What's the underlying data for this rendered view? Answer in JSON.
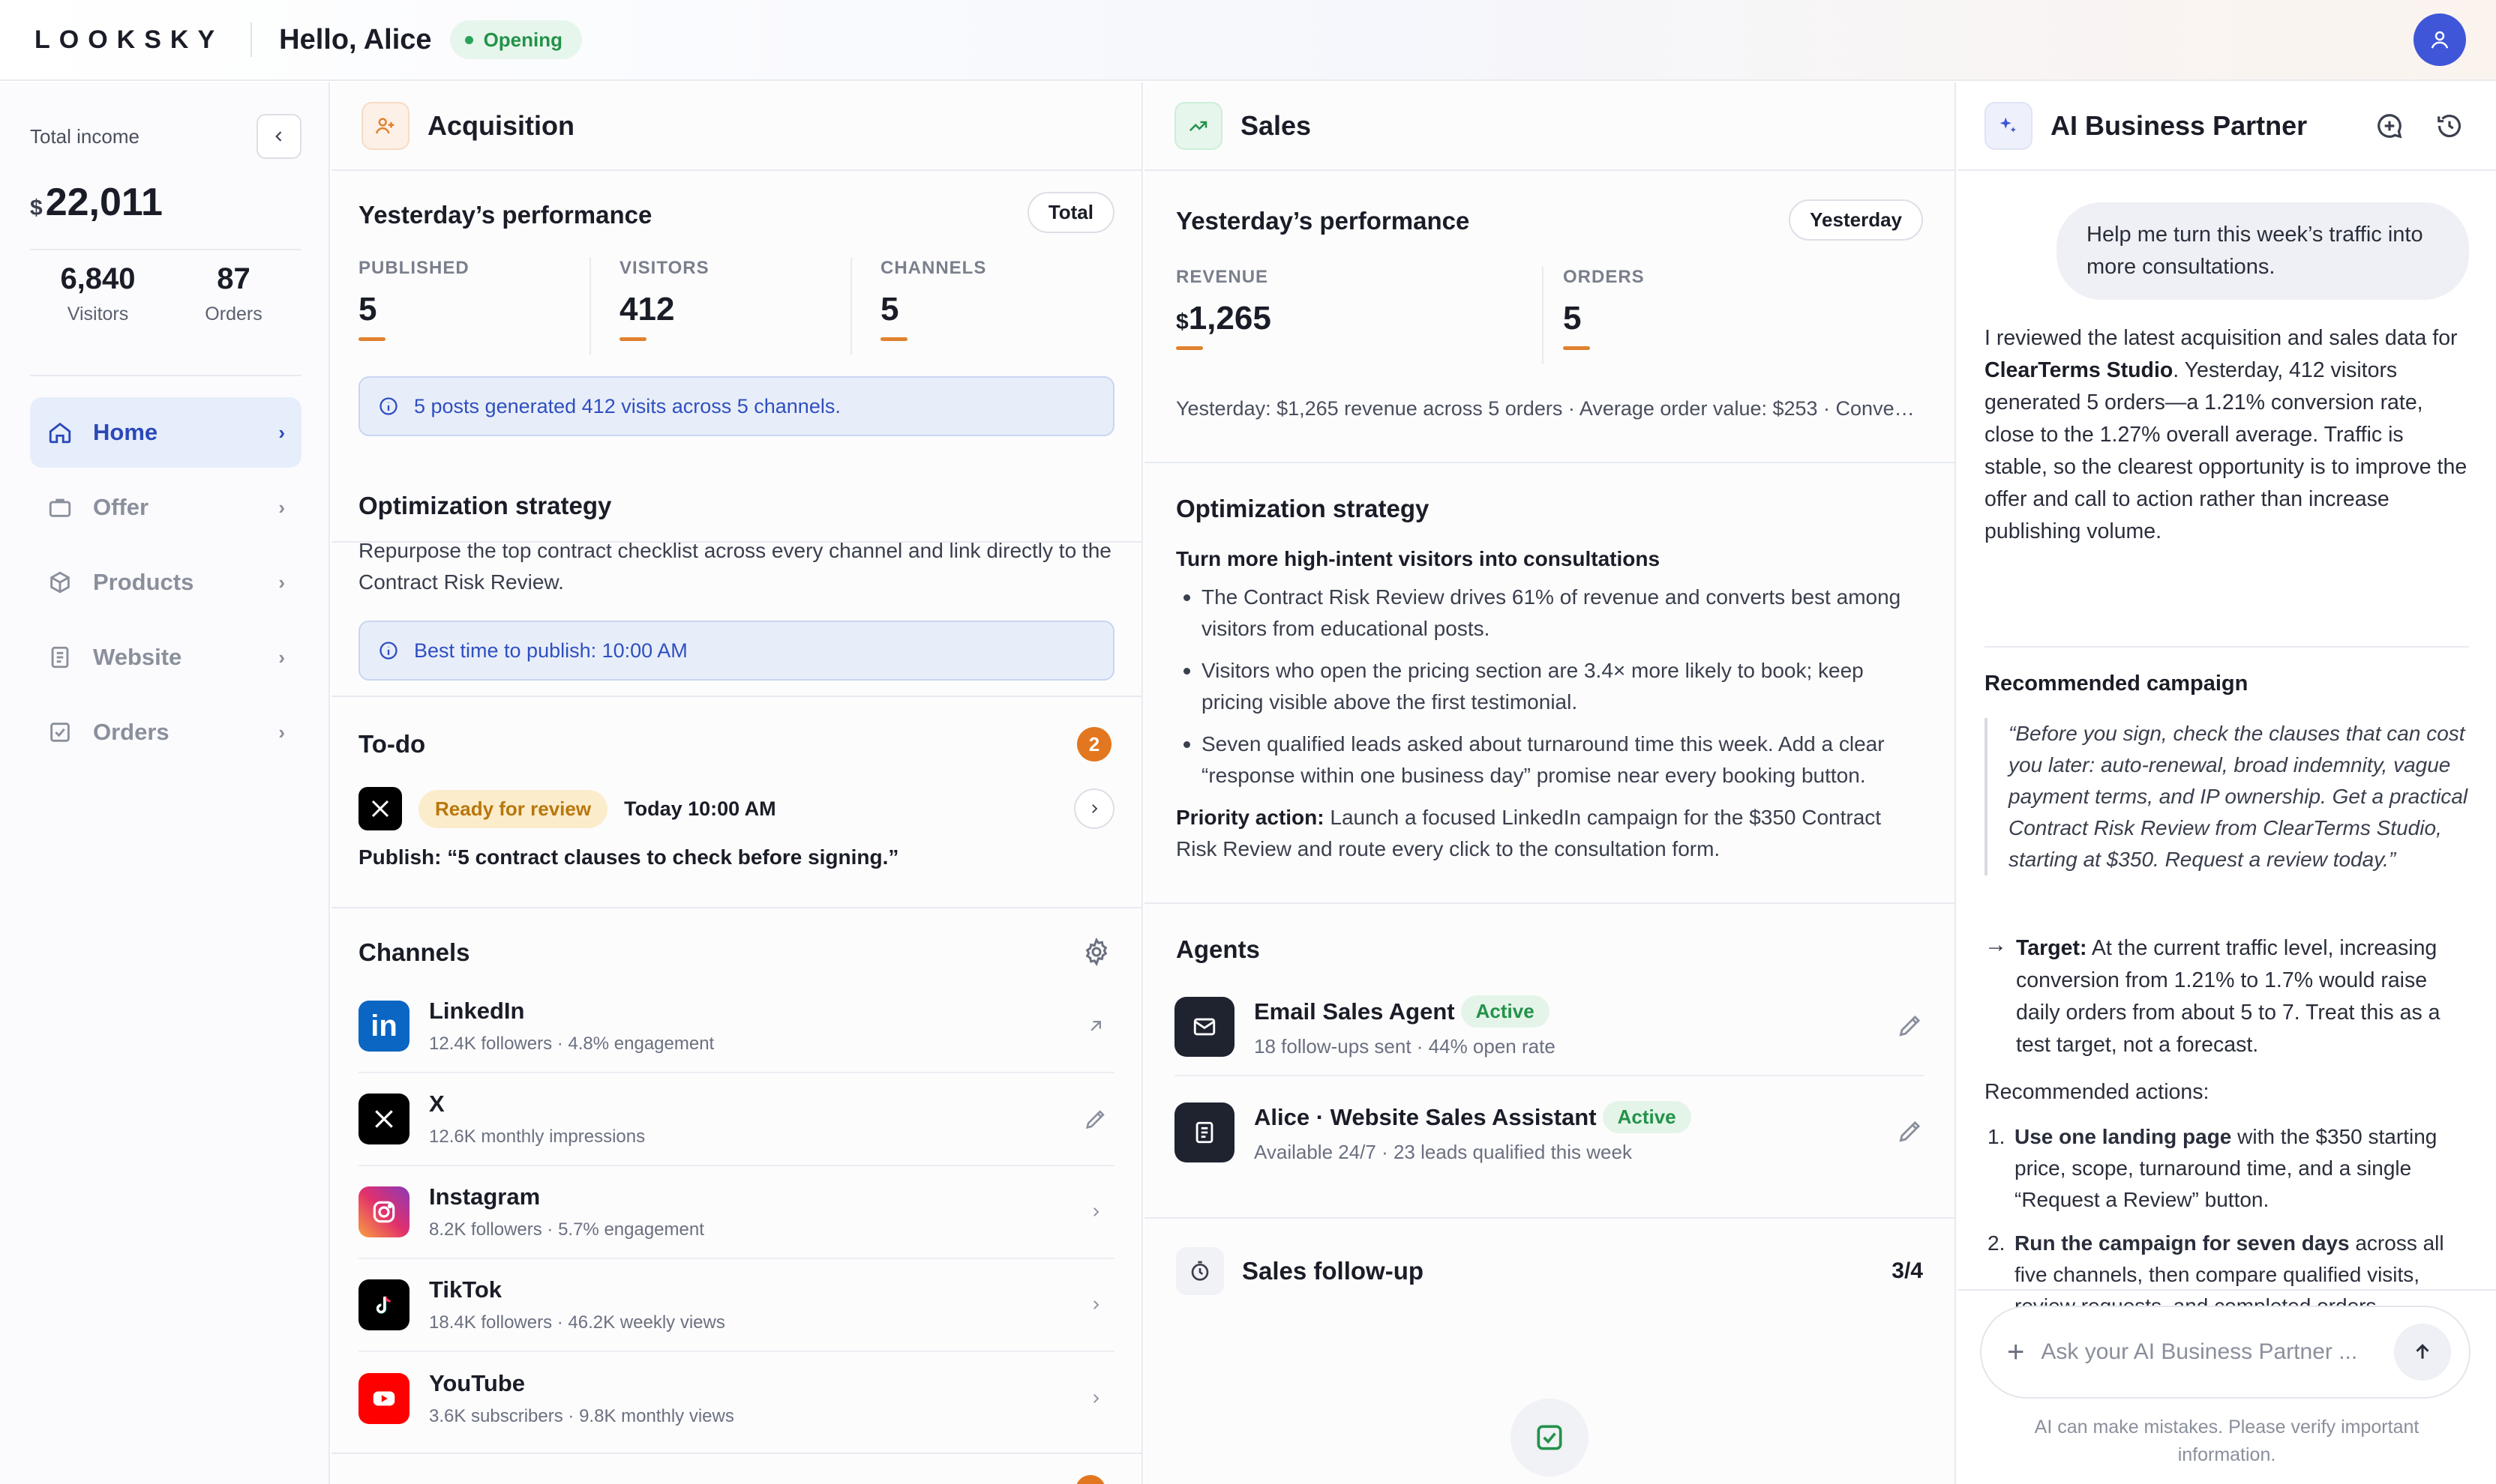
{
  "app": {
    "logo": "LOOKSKY",
    "greeting": "Hello, Alice",
    "status": "Opening"
  },
  "sidebar": {
    "income_label": "Total income",
    "income_currency": "$",
    "income_value": "22,011",
    "visitors_value": "6,840",
    "visitors_label": "Visitors",
    "orders_value": "87",
    "orders_label": "Orders",
    "items": [
      {
        "label": "Home",
        "icon": "home-icon"
      },
      {
        "label": "Offer",
        "icon": "briefcase-icon"
      },
      {
        "label": "Products",
        "icon": "box-icon"
      },
      {
        "label": "Website",
        "icon": "document-icon"
      },
      {
        "label": "Orders",
        "icon": "checkbox-icon"
      }
    ]
  },
  "acquisition": {
    "title": "Acquisition",
    "performance": {
      "title": "Yesterday’s performance",
      "chip": "Total",
      "metrics": [
        {
          "label": "PUBLISHED",
          "value": "5"
        },
        {
          "label": "VISITORS",
          "value": "412"
        },
        {
          "label": "CHANNELS",
          "value": "5"
        }
      ],
      "info": "5 posts generated 412 visits across 5 channels."
    },
    "strategy": {
      "title": "Optimization strategy",
      "text": "Repurpose the top contract checklist across every channel and link directly to the Contract Risk Review.",
      "info": "Best time to publish: 10:00 AM"
    },
    "todo": {
      "title": "To-do",
      "count": "2",
      "status": "Ready for review",
      "time": "Today 10:00 AM",
      "publish": "Publish: “5 contract clauses to check before signing.”"
    },
    "channels": {
      "title": "Channels",
      "items": [
        {
          "name": "LinkedIn",
          "sub": "12.4K followers · 4.8% engagement",
          "color": "#0a66c2"
        },
        {
          "name": "X",
          "sub": "12.6K monthly impressions",
          "color": "#000000"
        },
        {
          "name": "Instagram",
          "sub": "8.2K followers · 5.7% engagement",
          "color": "#e1306c"
        },
        {
          "name": "TikTok",
          "sub": "18.4K followers · 46.2K weekly views",
          "color": "#000000"
        },
        {
          "name": "YouTube",
          "sub": "3.6K subscribers · 9.8K monthly views",
          "color": "#ff0000"
        }
      ]
    }
  },
  "sales": {
    "title": "Sales",
    "performance": {
      "title": "Yesterday’s performance",
      "chip": "Yesterday",
      "revenue_label": "REVENUE",
      "revenue_currency": "$",
      "revenue_value": "1,265",
      "orders_label": "ORDERS",
      "orders_value": "5",
      "summary": "Yesterday: $1,265 revenue across 5 orders · Average order value: $253 · Conve…"
    },
    "strategy": {
      "title": "Optimization strategy",
      "subtitle": "Turn more high-intent visitors into consultations",
      "bullets": [
        "The Contract Risk Review drives 61% of revenue and converts best among visitors from educational posts.",
        "Visitors who open the pricing section are 3.4× more likely to book; keep pricing visible above the first testimonial.",
        "Seven qualified leads asked about turnaround time this week. Add a clear “response within one business day” promise near every booking button."
      ],
      "priority_label": "Priority action:",
      "priority_text": " Launch a focused LinkedIn campaign for the $350 Contract Risk Review and route every click to the consultation form."
    },
    "agents": {
      "title": "Agents",
      "items": [
        {
          "name": "Email Sales Agent",
          "status": "Active",
          "sub": "18 follow-ups sent · 44% open rate"
        },
        {
          "name": "Alice · Website Sales Assistant",
          "status": "Active",
          "sub": "Available 24/7 · 23 leads qualified this week"
        }
      ]
    },
    "followup": {
      "title": "Sales follow-up",
      "count": "3/4"
    }
  },
  "ai": {
    "title": "AI Business Partner",
    "user_message": "Help me turn this week’s traffic into more consultations.",
    "reply_p1_a": "I reviewed the latest acquisition and sales data for ",
    "reply_p1_b": "ClearTerms Studio",
    "reply_p1_c": ". Yesterday, 412 visitors generated 5 orders—a 1.21% conversion rate, close to the 1.27% overall average. Traffic is stable, so the clearest opportunity is to improve the offer and call to action rather than increase publishing volume.",
    "campaign_title": "Recommended campaign",
    "campaign_quote": "“Before you sign, check the clauses that can cost you later: auto-renewal, broad indemnity, vague payment terms, and IP ownership. Get a practical Contract Risk Review from ClearTerms Studio, starting at $350. Request a review today.”",
    "target_label": "Target:",
    "target_text": " At the current traffic level, increasing conversion from 1.21% to 1.7% would raise daily orders from about 5 to 7. Treat this as a test target, not a forecast.",
    "actions_title": "Recommended actions:",
    "actions": [
      {
        "bold": "Use one landing page",
        "rest": " with the $350 starting price, scope, turnaround time, and a single “Request a Review” button."
      },
      {
        "bold": "Run the campaign for seven days",
        "rest": " across all five channels, then compare qualified visits, review requests, and completed orders."
      }
    ],
    "input_placeholder": "Ask your AI Business Partner ...",
    "disclaimer": "AI can make mistakes. Please verify important information."
  },
  "colors": {
    "accent": "#3f56d8",
    "orange": "#e0822e",
    "green": "#23924a"
  }
}
